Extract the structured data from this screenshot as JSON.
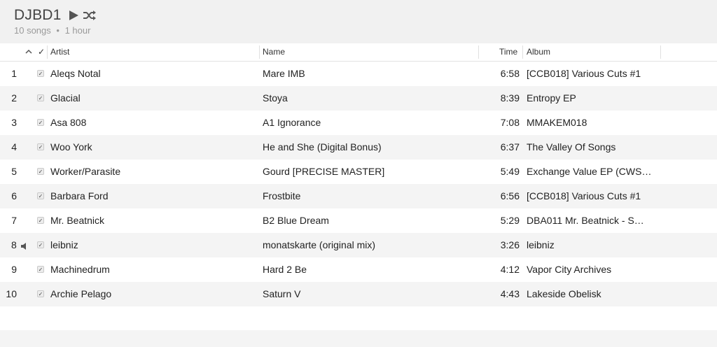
{
  "playlist": {
    "title": "DJBD1",
    "song_count": "10 songs",
    "separator": "•",
    "duration": "1 hour"
  },
  "columns": {
    "sort_indicator": "^",
    "check": "✓",
    "artist": "Artist",
    "name": "Name",
    "time": "Time",
    "album": "Album"
  },
  "rows": [
    {
      "num": "1",
      "artist": "Aleqs Notal",
      "name": "Mare IMB",
      "time": "6:58",
      "album": "[CCB018] Various Cuts #1"
    },
    {
      "num": "2",
      "artist": "Glacial",
      "name": "Stoya",
      "time": "8:39",
      "album": "Entropy EP"
    },
    {
      "num": "3",
      "artist": "Asa 808",
      "name": "A1 Ignorance",
      "time": "7:08",
      "album": "MMAKEM018"
    },
    {
      "num": "4",
      "artist": "Woo York",
      "name": "He and She (Digital Bonus)",
      "time": "6:37",
      "album": "The Valley Of Songs"
    },
    {
      "num": "5",
      "artist": "Worker/Parasite",
      "name": "Gourd [PRECISE MASTER]",
      "time": "5:49",
      "album": "Exchange Value EP (CWS…"
    },
    {
      "num": "6",
      "artist": "Barbara Ford",
      "name": "Frostbite",
      "time": "6:56",
      "album": "[CCB018] Various Cuts #1"
    },
    {
      "num": "7",
      "artist": "Mr. Beatnick",
      "name": "B2 Blue Dream",
      "time": "5:29",
      "album": "DBA011 Mr. Beatnick - S…"
    },
    {
      "num": "8",
      "artist": "leibniz",
      "name": "monatskarte (original mix)",
      "time": "3:26",
      "album": "leibniz",
      "playing": true
    },
    {
      "num": "9",
      "artist": "Machinedrum",
      "name": "Hard 2 Be",
      "time": "4:12",
      "album": "Vapor City Archives"
    },
    {
      "num": "10",
      "artist": "Archie Pelago",
      "name": "Saturn V",
      "time": "4:43",
      "album": "Lakeside Obelisk"
    }
  ],
  "icons": {
    "play": "play-icon",
    "shuffle": "shuffle-icon",
    "speaker": "speaker-icon",
    "checkbox": "checkbox"
  },
  "colors": {
    "title": "#444444",
    "meta": "#9a9a9a",
    "row_alt": "#f4f4f4"
  }
}
